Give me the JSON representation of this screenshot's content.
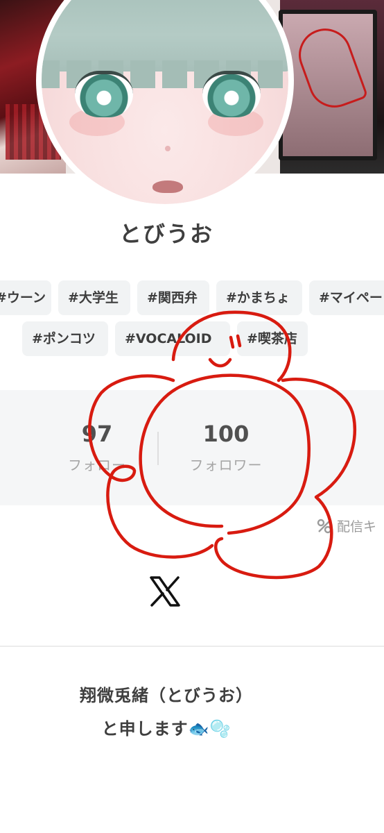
{
  "profile": {
    "name": "とびうお",
    "tags": [
      "#ウーン",
      "#大学生",
      "#関西弁",
      "#かまちょ",
      "#マイペー",
      "#ポンコツ",
      "#VOCALOID",
      "#喫茶店"
    ]
  },
  "stats": {
    "following_count": "97",
    "following_label": "フォロー",
    "followers_count": "100",
    "followers_label": "フォロワー"
  },
  "stream_label": "配信キ",
  "social": {
    "icon": "x-logo-icon"
  },
  "bio": {
    "line1": "翔微兎緒（とびうお）",
    "line2": "と申します🐟🫧"
  },
  "colors": {
    "annotation_red": "#d81b10",
    "tag_bg": "#f1f3f4",
    "stats_bg": "#f5f6f7"
  }
}
